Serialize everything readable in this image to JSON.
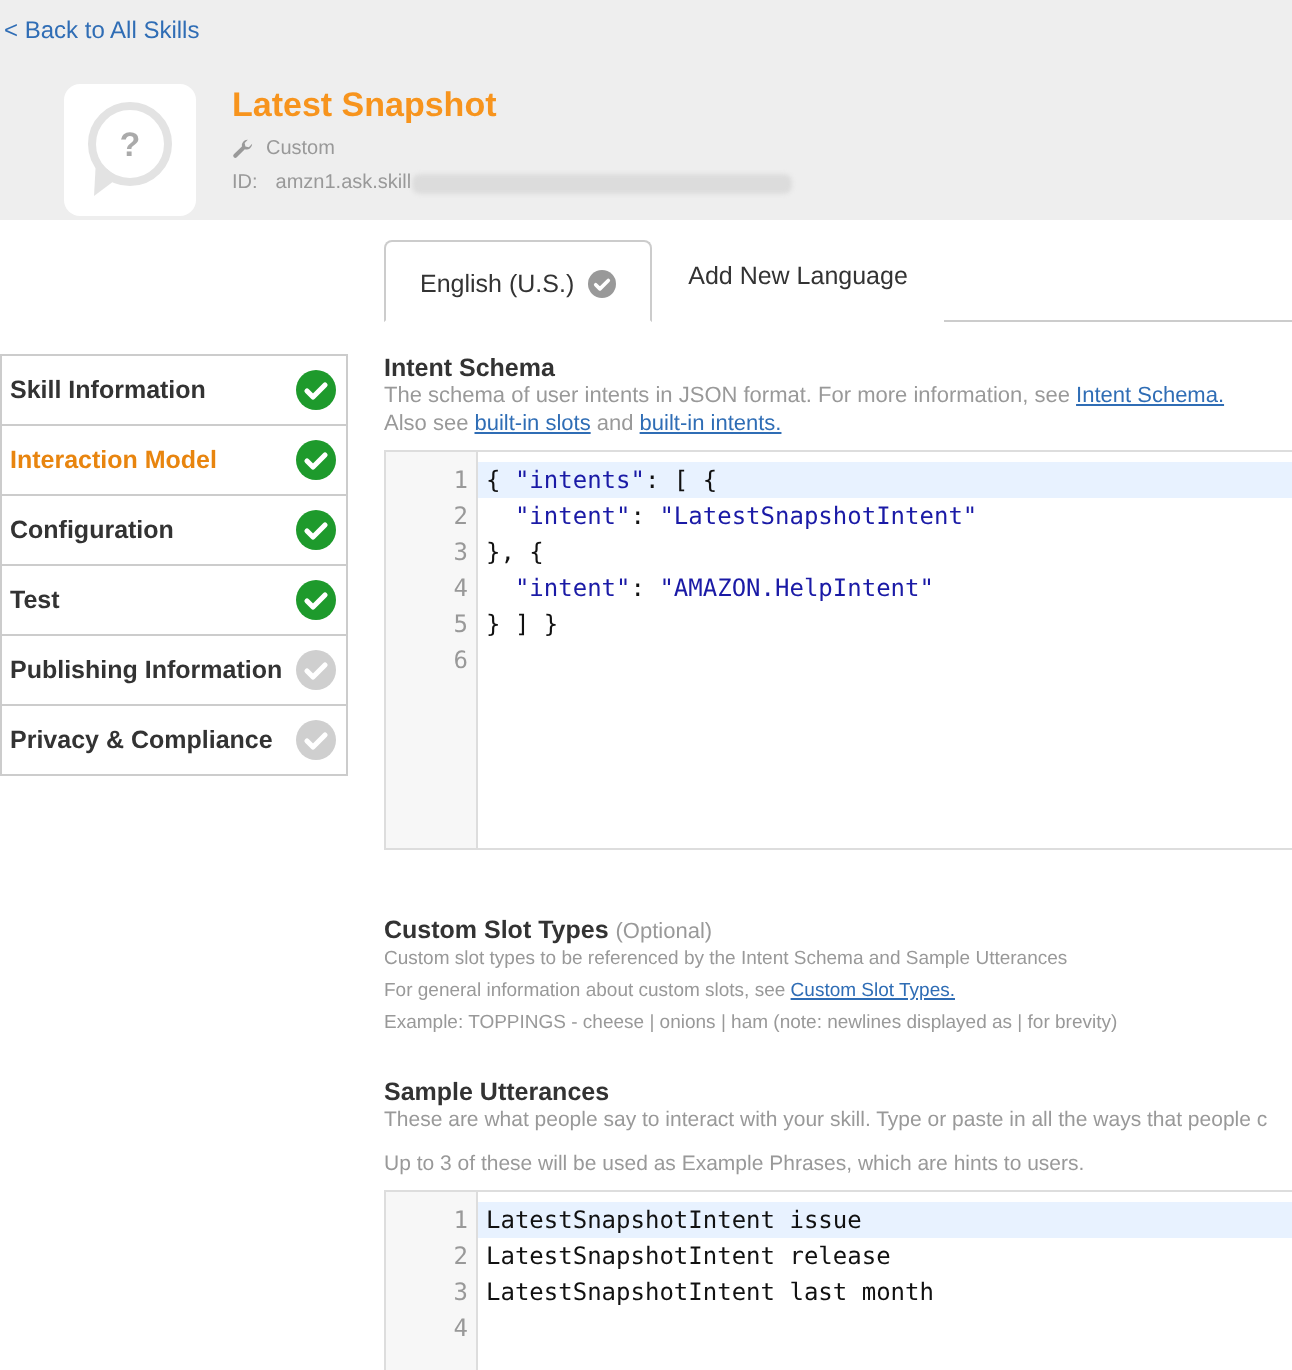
{
  "back_link": "< Back to All Skills",
  "skill": {
    "logo_glyph": "?",
    "title": "Latest Snapshot",
    "type": "Custom",
    "id_label": "ID:",
    "id_value": "amzn1.ask.skill",
    "id_redacted": true
  },
  "tabs": [
    {
      "label": "English (U.S.)",
      "selected": true,
      "checked": true
    },
    {
      "label": "Add New Language",
      "selected": false,
      "checked": false
    }
  ],
  "sidebar": {
    "items": [
      {
        "label": "Skill Information",
        "selected": false,
        "done": true
      },
      {
        "label": "Interaction Model",
        "selected": true,
        "done": true
      },
      {
        "label": "Configuration",
        "selected": false,
        "done": true
      },
      {
        "label": "Test",
        "selected": false,
        "done": true
      },
      {
        "label": "Publishing Information",
        "selected": false,
        "done": false
      },
      {
        "label": "Privacy & Compliance",
        "selected": false,
        "done": false
      }
    ]
  },
  "intent_schema": {
    "title": "Intent Schema",
    "help": [
      [
        {
          "text": "The schema of user intents in JSON format. For more information, see "
        },
        {
          "text": "Intent Schema.",
          "link": true
        }
      ],
      [
        {
          "text": "Also see "
        },
        {
          "text": "built-in slots",
          "link": true
        },
        {
          "text": " and "
        },
        {
          "text": "built-in intents.",
          "link": true
        }
      ]
    ],
    "editor": {
      "lines": [
        {
          "number": "1",
          "text": "{ \"intents\": [ {",
          "selected": true
        },
        {
          "number": "2",
          "text": "  \"intent\": \"LatestSnapshotIntent\"",
          "selected": false
        },
        {
          "number": "3",
          "text": "}, {",
          "selected": false
        },
        {
          "number": "4",
          "text": "  \"intent\": \"AMAZON.HelpIntent\"",
          "selected": false
        },
        {
          "number": "5",
          "text": "} ] }",
          "selected": false
        },
        {
          "number": "6",
          "selected": false
        }
      ]
    }
  },
  "custom_slot_types": {
    "title": "Custom Slot Types",
    "note": "(Optional)",
    "help": [
      [
        {
          "text": "Custom slot types to be referenced by the Intent Schema and Sample Utterances"
        }
      ],
      [
        {
          "text": "For general information about custom slots, see "
        },
        {
          "text": "Custom Slot Types.",
          "link": true
        }
      ],
      [
        {
          "text": "Example: TOPPINGS - cheese | onions | ham (note: newlines displayed as | for brevity)"
        }
      ]
    ]
  },
  "sample_utterances": {
    "title": "Sample Utterances",
    "help": [
      [
        {
          "text": "These are what people say to interact with your skill. Type or paste in all the ways that people c"
        }
      ],
      [
        {
          "text": "Up to 3 of these will be used as Example Phrases, which are hints to users."
        }
      ]
    ],
    "editor": {
      "lines": [
        {
          "number": "1",
          "text": "LatestSnapshotIntent issue",
          "selected": true
        },
        {
          "number": "2",
          "text": "LatestSnapshotIntent release",
          "selected": false
        },
        {
          "number": "3",
          "text": "LatestSnapshotIntent last month",
          "selected": false
        },
        {
          "number": "4",
          "selected": false
        }
      ]
    }
  }
}
